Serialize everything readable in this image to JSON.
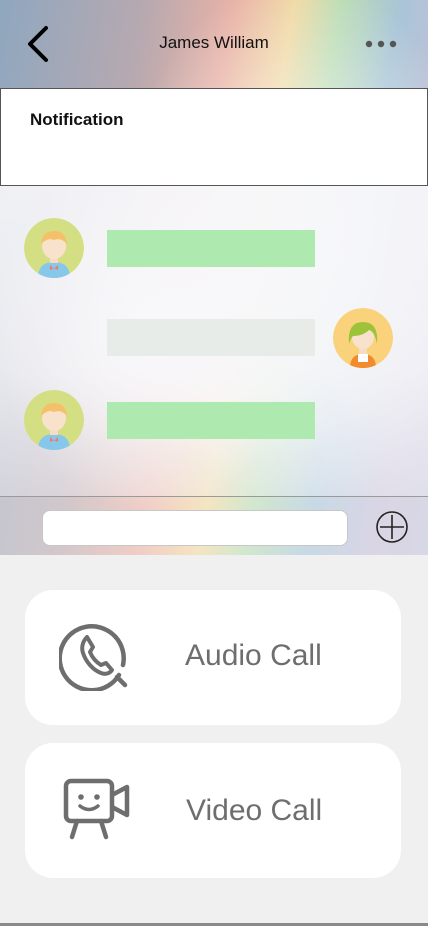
{
  "header": {
    "title": "James William",
    "back_icon": "chevron-left-icon",
    "more_icon": "more-horizontal-icon"
  },
  "notification": {
    "title": "Notification"
  },
  "chat": {
    "messages": [
      {
        "sender": "contact",
        "bubble_color": "#aeeab0",
        "avatar": "boy-avatar-icon"
      },
      {
        "sender": "me",
        "bubble_color": "#e8ece8",
        "avatar": "girl-avatar-icon"
      },
      {
        "sender": "contact",
        "bubble_color": "#aeeab0",
        "avatar": "boy-avatar-icon"
      }
    ]
  },
  "composer": {
    "input_value": "",
    "input_placeholder": "",
    "add_icon": "plus-circle-icon"
  },
  "actions": {
    "audio_call_label": "Audio Call",
    "audio_call_icon": "phone-circle-icon",
    "video_call_label": "Video Call",
    "video_call_icon": "video-camera-icon"
  },
  "colors": {
    "incoming_bubble": "#aeeab0",
    "outgoing_bubble": "#e8ece8",
    "call_label": "#6e6e6e",
    "panel_bg": "#f0f0f0"
  }
}
